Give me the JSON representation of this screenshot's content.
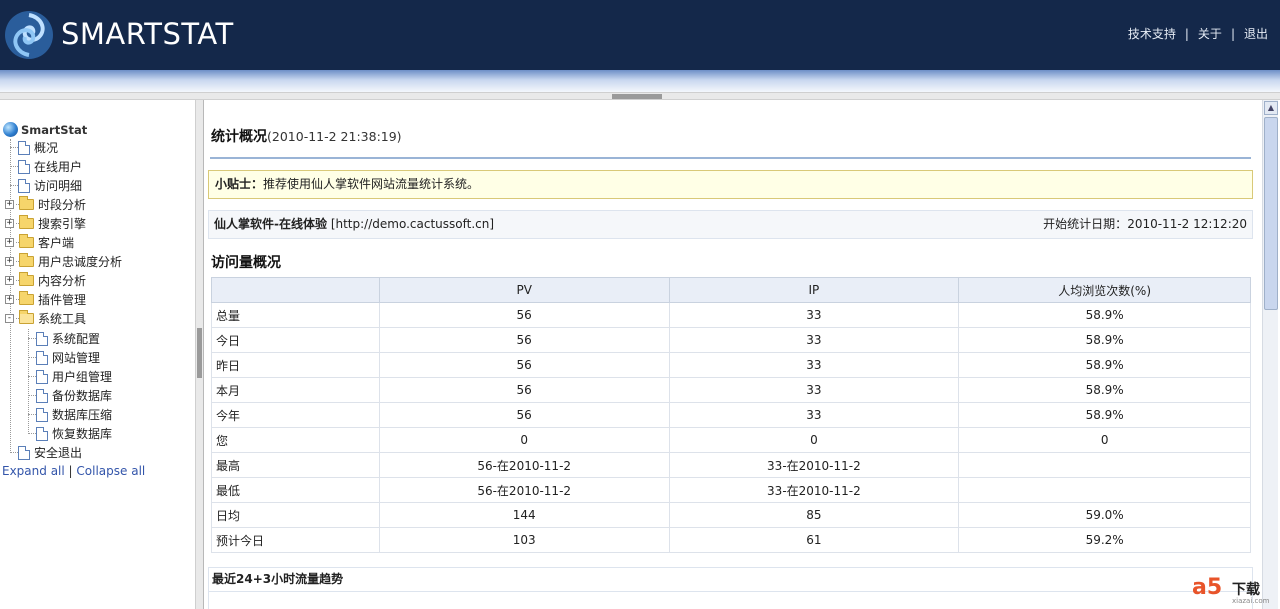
{
  "header": {
    "brand": "SMARTSTAT",
    "links": [
      "技术支持",
      "关于",
      "退出"
    ],
    "separator": "|"
  },
  "sidebar": {
    "root": "SmartStat",
    "items": [
      {
        "label": "概况",
        "icon": "doc-icon"
      },
      {
        "label": "在线用户",
        "icon": "doc-icon"
      },
      {
        "label": "访问明细",
        "icon": "doc-icon"
      },
      {
        "label": "时段分析",
        "icon": "folder-icon",
        "toggle": "+"
      },
      {
        "label": "搜索引擎",
        "icon": "folder-icon",
        "toggle": "+"
      },
      {
        "label": "客户端",
        "icon": "folder-icon",
        "toggle": "+"
      },
      {
        "label": "用户忠诚度分析",
        "icon": "folder-icon",
        "toggle": "+"
      },
      {
        "label": "内容分析",
        "icon": "folder-icon",
        "toggle": "+"
      },
      {
        "label": "插件管理",
        "icon": "folder-icon",
        "toggle": "+"
      },
      {
        "label": "系统工具",
        "icon": "folder-open-icon",
        "toggle": "-"
      },
      {
        "label": "系统配置",
        "icon": "doc-icon"
      },
      {
        "label": "网站管理",
        "icon": "doc-icon"
      },
      {
        "label": "用户组管理",
        "icon": "doc-icon"
      },
      {
        "label": "备份数据库",
        "icon": "doc-icon"
      },
      {
        "label": "数据库压缩",
        "icon": "doc-icon"
      },
      {
        "label": "恢复数据库",
        "icon": "doc-icon"
      },
      {
        "label": "安全退出",
        "icon": "doc-icon"
      }
    ],
    "expand_all": "Expand all",
    "collapse_all": "Collapse all",
    "sep": "|"
  },
  "main": {
    "title": "统计概况",
    "timestamp": "(2010-11-2 21:38:19)",
    "tip_label": "小贴士：",
    "tip_text": "推荐使用仙人掌软件网站流量统计系统。",
    "site_name": "仙人掌软件-在线体验",
    "site_url": "[http://demo.cactussoft.cn]",
    "start_label": "开始统计日期：",
    "start_date": "2010-11-2 12:12:20",
    "section_title": "访问量概况",
    "table": {
      "headers": [
        "",
        "PV",
        "IP",
        "人均浏览次数(%)"
      ],
      "rows": [
        [
          "总量",
          "56",
          "33",
          "58.9%"
        ],
        [
          "今日",
          "56",
          "33",
          "58.9%"
        ],
        [
          "昨日",
          "56",
          "33",
          "58.9%"
        ],
        [
          "本月",
          "56",
          "33",
          "58.9%"
        ],
        [
          "今年",
          "56",
          "33",
          "58.9%"
        ],
        [
          "您",
          "0",
          "0",
          "0"
        ],
        [
          "最高",
          "56-在2010-11-2",
          "33-在2010-11-2",
          ""
        ],
        [
          "最低",
          "56-在2010-11-2",
          "33-在2010-11-2",
          ""
        ],
        [
          "日均",
          "144",
          "85",
          "59.0%"
        ],
        [
          "预计今日",
          "103",
          "61",
          "59.2%"
        ]
      ]
    },
    "trend_title": "最近24+3小时流量趋势"
  },
  "watermark": {
    "logo": "a5",
    "text": "下载",
    "url": "xiazai.com"
  },
  "colors": {
    "header_bg": "#14284a",
    "table_header_bg": "#e9eef7",
    "tip_bg": "#ffffe6",
    "link": "#3355aa"
  }
}
